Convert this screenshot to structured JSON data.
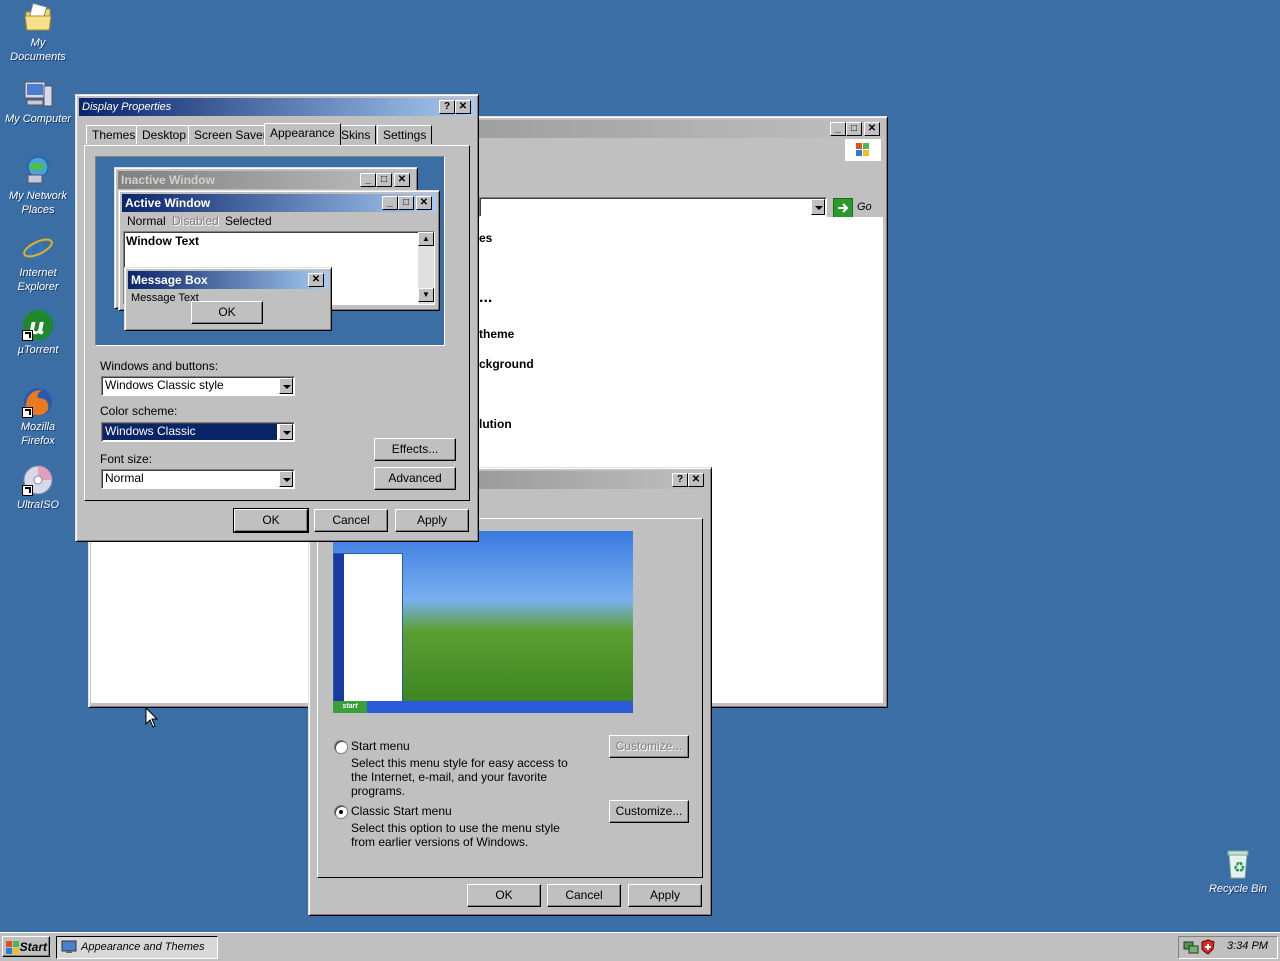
{
  "desktop": {
    "icons": [
      {
        "label": "My Documents"
      },
      {
        "label": "My Computer"
      },
      {
        "label": "My Network Places"
      },
      {
        "label": "Internet Explorer"
      },
      {
        "label": "µTorrent"
      },
      {
        "label": "Mozilla Firefox"
      },
      {
        "label": "UltraISO"
      },
      {
        "label": "Recycle Bin"
      }
    ]
  },
  "bg_window": {
    "go_label": "Go",
    "fragments": [
      "es",
      "...",
      "theme",
      "ckground",
      "lution"
    ]
  },
  "display_props": {
    "title": "Display Properties",
    "help": "?",
    "close": "✕",
    "tabs": [
      "Themes",
      "Desktop",
      "Screen Saver",
      "Appearance",
      "Skins",
      "Settings"
    ],
    "preview": {
      "inactive_title": "Inactive Window",
      "active_title": "Active Window",
      "menu_normal": "Normal",
      "menu_disabled": "Disabled",
      "menu_selected": "Selected",
      "window_text": "Window Text",
      "msgbox_title": "Message Box",
      "msgbox_text": "Message Text",
      "msgbox_ok": "OK"
    },
    "windows_buttons_label": "Windows and buttons:",
    "windows_buttons_value": "Windows Classic style",
    "color_scheme_label": "Color scheme:",
    "color_scheme_value": "Windows Classic",
    "font_size_label": "Font size:",
    "font_size_value": "Normal",
    "effects": "Effects...",
    "advanced": "Advanced",
    "ok": "OK",
    "cancel": "Cancel",
    "apply": "Apply"
  },
  "taskbar_props": {
    "help": "?",
    "close": "✕",
    "start_menu_label": "Start menu",
    "start_menu_desc": "Select this menu style for easy access to the Internet, e-mail, and your favorite programs.",
    "customize1": "Customize...",
    "classic_label": "Classic Start menu",
    "classic_desc": "Select this option to use the menu style from earlier versions of Windows.",
    "customize2": "Customize...",
    "ok": "OK",
    "cancel": "Cancel",
    "apply": "Apply",
    "preview_start": "start"
  },
  "taskbar": {
    "start": "Start",
    "task": "Appearance and Themes",
    "clock": "3:34 PM"
  },
  "colors": {
    "desktop": "#3a6ea5",
    "face": "#c0c0c0",
    "active_title": "#0a246a",
    "selection": "#0a246a"
  }
}
